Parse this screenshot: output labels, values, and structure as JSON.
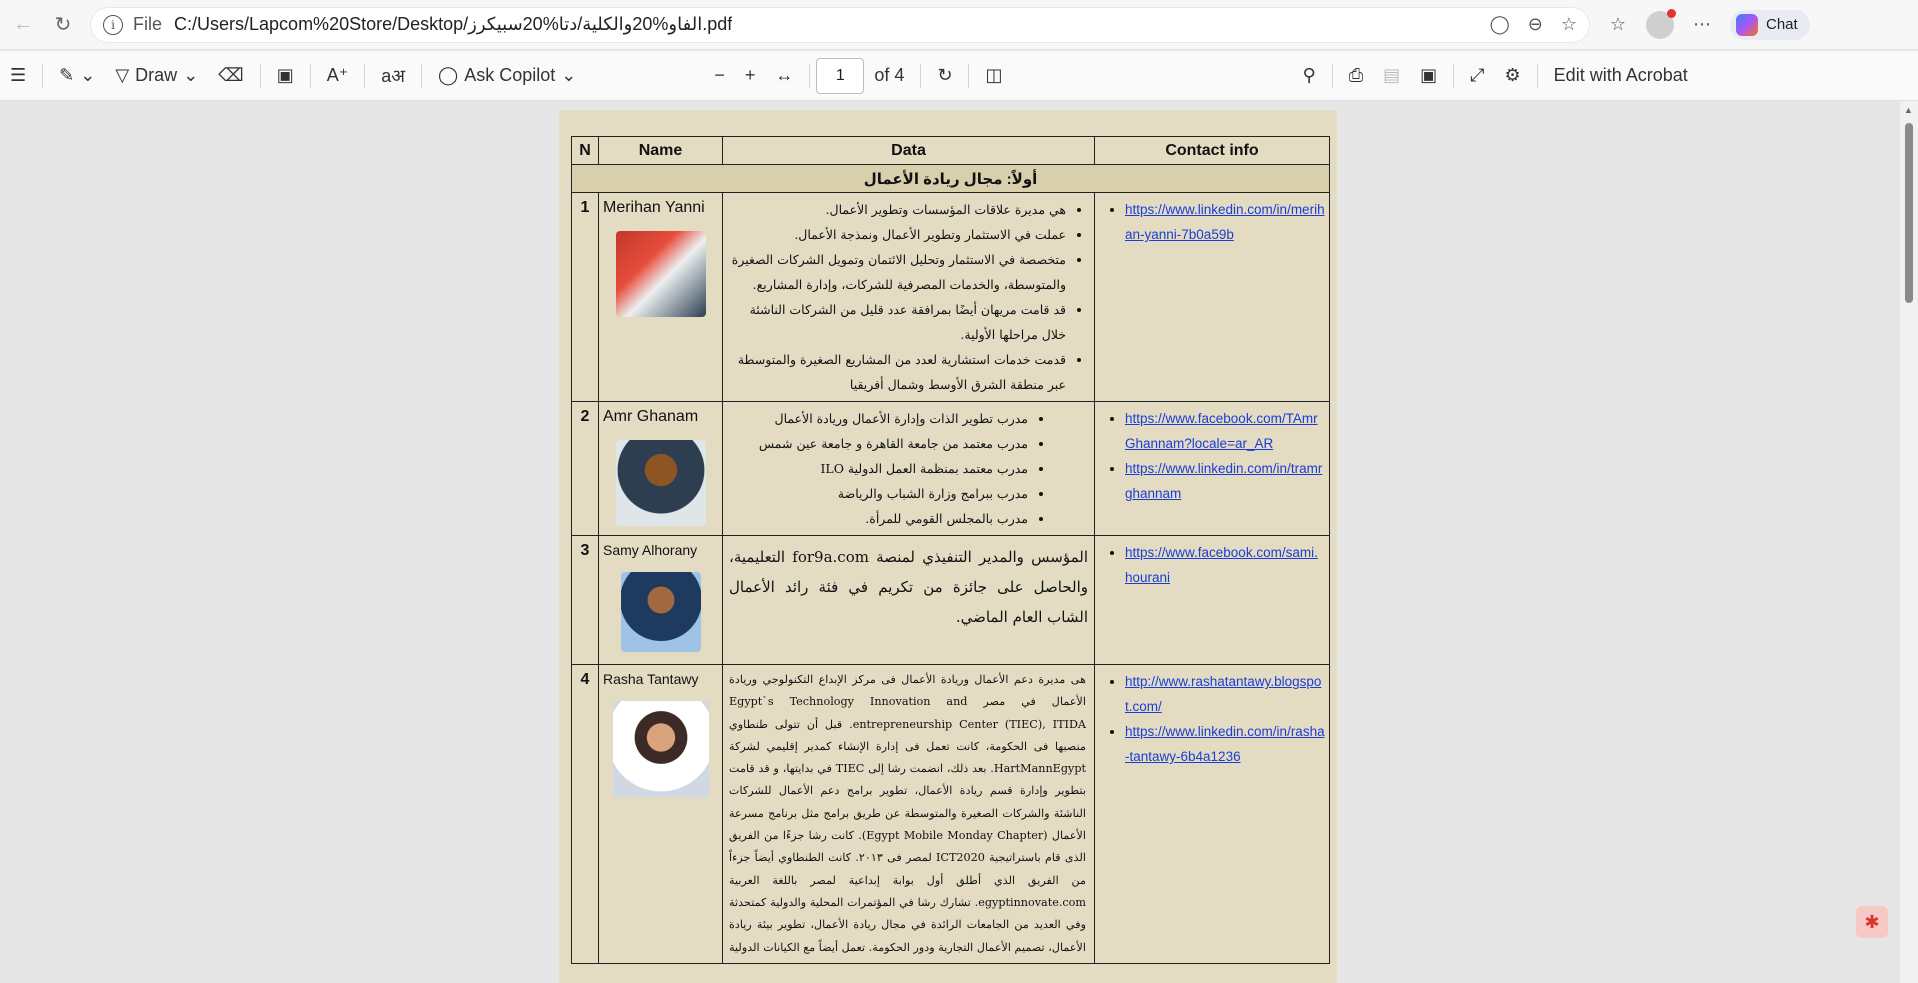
{
  "browser": {
    "file_label": "File",
    "url": "C:/Users/Lapcom%20Store/Desktop/الفاو%20والكلية/دتا%20سبيكرز.pdf",
    "chat_label": "Chat"
  },
  "toolbar": {
    "draw_label": "Draw",
    "copilot_label": "Ask Copilot",
    "page_current": "1",
    "page_total": "of 4",
    "acrobat_label": "Edit with Acrobat"
  },
  "doc": {
    "headers": {
      "n": "N",
      "name": "Name",
      "data": "Data",
      "contact": "Contact info"
    },
    "section_title": "أولاً: مجال ريادة الأعمال",
    "rows": [
      {
        "n": "1",
        "name": "Merihan Yanni",
        "data": [
          "هي مديرة علاقات المؤسسات وتطوير الأعمال.",
          "عملت في الاستثمار وتطوير الأعمال ونمذجة الأعمال.",
          "متخصصة في الاستثمار وتحليل الائتمان وتمويل الشركات الصغيرة والمتوسطة، والخدمات المصرفية للشركات، وإدارة المشاريع.",
          "قد قامت مريهان أيضًا بمرافقة عدد قليل من الشركات الناشئة خلال مراحلها الأولية.",
          "قدمت خدمات استشارية لعدد من المشاريع الصغيرة والمتوسطة عبر منطقة الشرق الأوسط وشمال أفريقيا"
        ],
        "contact": [
          "https://www.linkedin.com/in/merihan-yanni-7b0a59b"
        ]
      },
      {
        "n": "2",
        "name": "Amr Ghanam",
        "data": [
          "مدرب تطوير الذات وإدارة الأعمال وريادة الأعمال",
          "مدرب معتمد من جامعة القاهرة و جامعة عين شمس",
          "مدرب معتمد بمنظمة العمل الدولية ILO",
          "مدرب ببرامج وزارة الشباب والرياضة",
          "مدرب بالمجلس القومي للمرأة."
        ],
        "contact": [
          "https://www.facebook.com/TAmrGhannam?locale=ar_AR",
          "https://www.linkedin.com/in/tramrghannam"
        ]
      },
      {
        "n": "3",
        "name": "Samy Alhorany",
        "data_text": "المؤسس والمدير التنفيذي لمنصة for9a.com التعليمية، والحاصل على جائزة من تكريم في فئة رائد الأعمال الشاب العام الماضي.",
        "contact": [
          "https://www.facebook.com/sami.hourani"
        ]
      },
      {
        "n": "4",
        "name": "Rasha Tantawy",
        "data_text": "هى مديرة دعم الأعمال وريادة الأعمال فى مركز الإبداع التكنولوجي وريادة الأعمال في مصر Egypt`s Technology Innovation and entrepreneurship Center (TIEC), ITIDA. قبل أن تتولى طنطاوي منصبها فى الحكومة، كانت تعمل فى إدارة الإنشاء كمدير إقليمي لشركة HartMannEgypt. بعد ذلك، انضمت رشا إلى TIEC في بدايتها، و قد قامت بتطوير وإدارة قسم ريادة الأعمال، تطوير برامج دعم الأعمال للشركات الناشئة والشركات الصغيرة والمتوسطة عن طريق برامج مثل برنامج مسرعة الأعمال (Egypt Mobile Monday Chapter). كانت رشا جزءًا من الفريق الذى قام باستراتيجية ICT2020 لمصر فى ٢٠١٣. كانت الطنطاوي أيضاً جزءاً من الفريق الذي أطلق أول بوابة إبداعية لمصر باللغة العربية egyptinnovate.com. تشارك رشا في المؤتمرات المحلية والدولية كمتحدثة وفي العديد من الجامعات الرائدة في مجال ريادة الأعمال، تطوير بيئة ريادة الأعمال، تصميم الأعمال التجارية ودور الحكومة. تعمل أيضاً مع الكيانات الدولية",
        "contact": [
          "http://www.rashatantawy.blogspot.com/",
          "https://www.linkedin.com/in/rasha-tantawy-6b4a1236"
        ]
      }
    ]
  }
}
